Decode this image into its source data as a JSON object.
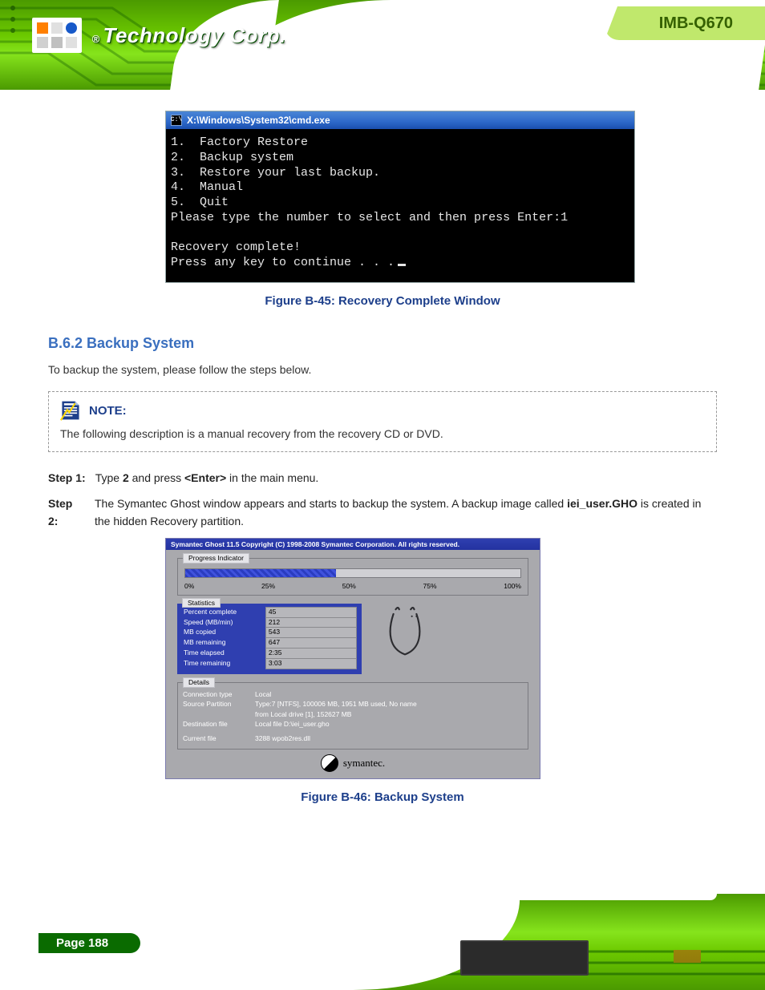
{
  "product_name": "IMB-Q670",
  "logo_text": "Technology Corp.",
  "figure45": {
    "window_title": "X:\\Windows\\System32\\cmd.exe",
    "menu": [
      "1.  Factory Restore",
      "2.  Backup system",
      "3.  Restore your last backup.",
      "4.  Manual",
      "5.  Quit"
    ],
    "prompt": "Please type the number to select and then press Enter:1",
    "msg1": "Recovery complete!",
    "msg2": "Press any key to continue . . .",
    "caption": "Figure B-45: Recovery Complete Window"
  },
  "section": {
    "heading": "B.6.2  Backup System",
    "para1": "To backup the system, please follow the steps below.",
    "note_label": "NOTE:",
    "note_body": "The following description is a manual recovery from the recovery CD or DVD.",
    "step0_n": "Step 1:",
    "step0_t_a": "Type ",
    "step0_t_b": "2",
    "step0_t_c": " and press ",
    "step0_t_d": "<Enter>",
    "step0_t_e": " in the main menu.",
    "step1_n": "Step 2:",
    "step1_t_a": "The Symantec Ghost window appears and starts to backup the system. A backup image called ",
    "step1_t_b": "iei_user.GHO",
    "step1_t_c": " is created in the hidden Recovery partition."
  },
  "figure46": {
    "window_title": "Symantec Ghost 11.5   Copyright (C) 1998-2008 Symantec Corporation. All rights reserved.",
    "progress_legend": "Progress Indicator",
    "ticks": [
      "0%",
      "25%",
      "50%",
      "75%",
      "100%"
    ],
    "stats_legend": "Statistics",
    "stats": {
      "percent_complete": "45",
      "speed": "212",
      "mb_copied": "543",
      "mb_remaining": "647",
      "time_elapsed": "2:35",
      "time_remaining": "3:03"
    },
    "stats_labels": {
      "percent_complete": "Percent complete",
      "speed": "Speed (MB/min)",
      "mb_copied": "MB copied",
      "mb_remaining": "MB remaining",
      "time_elapsed": "Time elapsed",
      "time_remaining": "Time remaining"
    },
    "details_legend": "Details",
    "details": {
      "conn_type_k": "Connection type",
      "conn_type_v": "Local",
      "src_part_k": "Source Partition",
      "src_part_v1": "Type:7 [NTFS], 100006 MB, 1951 MB used, No name",
      "src_part_v2": "from Local drive [1], 152627 MB",
      "dst_k": "Destination file",
      "dst_v": "Local file D:\\iei_user.gho",
      "cur_k": "Current file",
      "cur_v": "3288 wpob2res.dll"
    },
    "brand": "symantec.",
    "caption": "Figure B-46: Backup System"
  },
  "chart_data": {
    "type": "bar",
    "title": "Ghost backup progress",
    "categories": [
      "progress"
    ],
    "values": [
      45
    ],
    "ylim": [
      0,
      100
    ],
    "xlabel": "",
    "ylabel": "Percent complete"
  },
  "page_label": "Page 188"
}
